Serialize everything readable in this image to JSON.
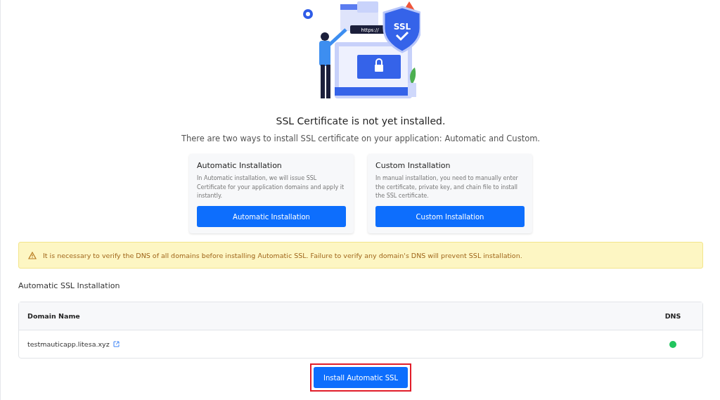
{
  "illustration": {
    "badge_text": "SSL",
    "url_text": "https://"
  },
  "title": "SSL Certificate is not yet installed.",
  "subtitle": "There are two ways to install SSL certificate on your application: Automatic and Custom.",
  "options": [
    {
      "title": "Automatic Installation",
      "description": "In Automatic installation, we will issue SSL Certificate for your application domains and apply it instantly.",
      "button": "Automatic Installation"
    },
    {
      "title": "Custom Installation",
      "description": "In manual installation, you need to manually enter the certificate, private key, and chain file to install the SSL certificate.",
      "button": "Custom Installation"
    }
  ],
  "alert": {
    "text": "It is necessary to verify the DNS of all domains before installing Automatic SSL. Failure to verify any domain's DNS will prevent SSL installation."
  },
  "section_title": "Automatic SSL Installation",
  "table": {
    "columns": [
      "Domain Name",
      "DNS"
    ],
    "rows": [
      {
        "domain": "testmauticapp.litesa.xyz",
        "dns_verified": true
      }
    ]
  },
  "install_button": {
    "label": "Install Automatic SSL",
    "highlighted": true
  }
}
